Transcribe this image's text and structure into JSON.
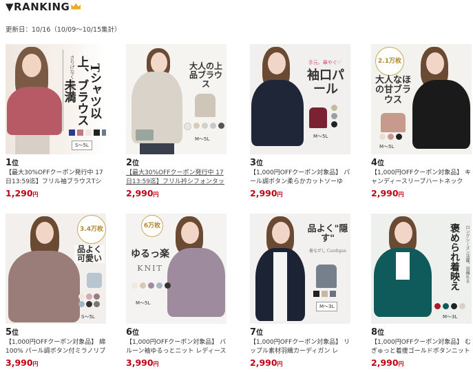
{
  "header": {
    "title": "▼RANKING",
    "crown_icon": "crown-icon"
  },
  "updated": "更新日：10/16（10/09～10/15集計）",
  "items": [
    {
      "rank": "1",
      "unit": "位",
      "desc": "【最大30%OFFクーポン発行中 17日13:59迄】フリル袖ブラウスTシャツ",
      "price": "1,290",
      "yen": "円",
      "img": {
        "caption": "Tシャツ以上、ブラウス未満",
        "sub": "さりげなく上品に。",
        "size": "S～5L",
        "top": "#b85a66",
        "bg": "#f3ede8"
      }
    },
    {
      "rank": "2",
      "unit": "位",
      "desc": "【最大30%OFFクーポン発行中 17日13:59迄】フリル衿シフォンタッ",
      "price": "2,990",
      "yen": "円",
      "link": true,
      "img": {
        "caption": "大人の上品ブラウス",
        "size": "M～5L",
        "top": "#d9d3c9",
        "bg": "#f6f4f0"
      }
    },
    {
      "rank": "3",
      "unit": "位",
      "desc": "【1,000円OFFクーポン対象品】 パール調ボタン柔らかカットソーゆ",
      "price": "2,990",
      "yen": "円",
      "img": {
        "caption": "袖口パール",
        "sub": "手元、華やぐ♡",
        "size": "M～5L",
        "top": "#1f2638",
        "bg": "#f2f0ee"
      }
    },
    {
      "rank": "4",
      "unit": "位",
      "desc": "【1,000円OFFクーポン対象品】 キャンディースリーブハートネック",
      "price": "2,990",
      "yen": "円",
      "img": {
        "caption": "大人なほの甘ブラウス",
        "badge": "2.1万枚",
        "size": "M～5L",
        "top": "#1a1a1a",
        "bg": "#f4f2ee"
      }
    },
    {
      "rank": "5",
      "unit": "位",
      "desc": "【1,000円OFFクーポン対象品】 綿100% パール調ボタン付ミラノリブ",
      "price": "3,990",
      "yen": "円",
      "img": {
        "caption": "品よく可愛い",
        "badge": "3.4万枚",
        "size": "S～5L",
        "top": "#9a7d78",
        "bg": "#f3efec"
      }
    },
    {
      "rank": "6",
      "unit": "位",
      "desc": "【1,000円OFFクーポン対象品】 バルーン袖ゆるっとニット レディース 春",
      "price": "3,990",
      "yen": "円",
      "img": {
        "caption": "ゆるっ楽",
        "sub": "KNIT",
        "badge": "6万枚",
        "size": "M～5L",
        "top": "#9e8c9e",
        "bg": "#f5f3f1"
      }
    },
    {
      "rank": "7",
      "unit": "位",
      "desc": "【1,000円OFFクーポン対象品】 リップル素材羽織カーディガン レ",
      "price": "2,990",
      "yen": "円",
      "img": {
        "caption": "品よく\"隠す\"",
        "sub": "着ながし Cardigan",
        "size": "M～3L",
        "top": "#1c2335",
        "bg": "#f3f1ef"
      }
    },
    {
      "rank": "8",
      "unit": "位",
      "desc": "【1,000円OFFクーポン対象品】 むぎゅっと着痩ゴールドボタンニット",
      "price": "2,990",
      "yen": "円",
      "img": {
        "caption": "褒められ着映え",
        "sub": "ロングシーズン活躍、羽織れる",
        "size": "M～3L",
        "top": "#0f5a5a",
        "bg": "#eef0ee"
      }
    }
  ]
}
